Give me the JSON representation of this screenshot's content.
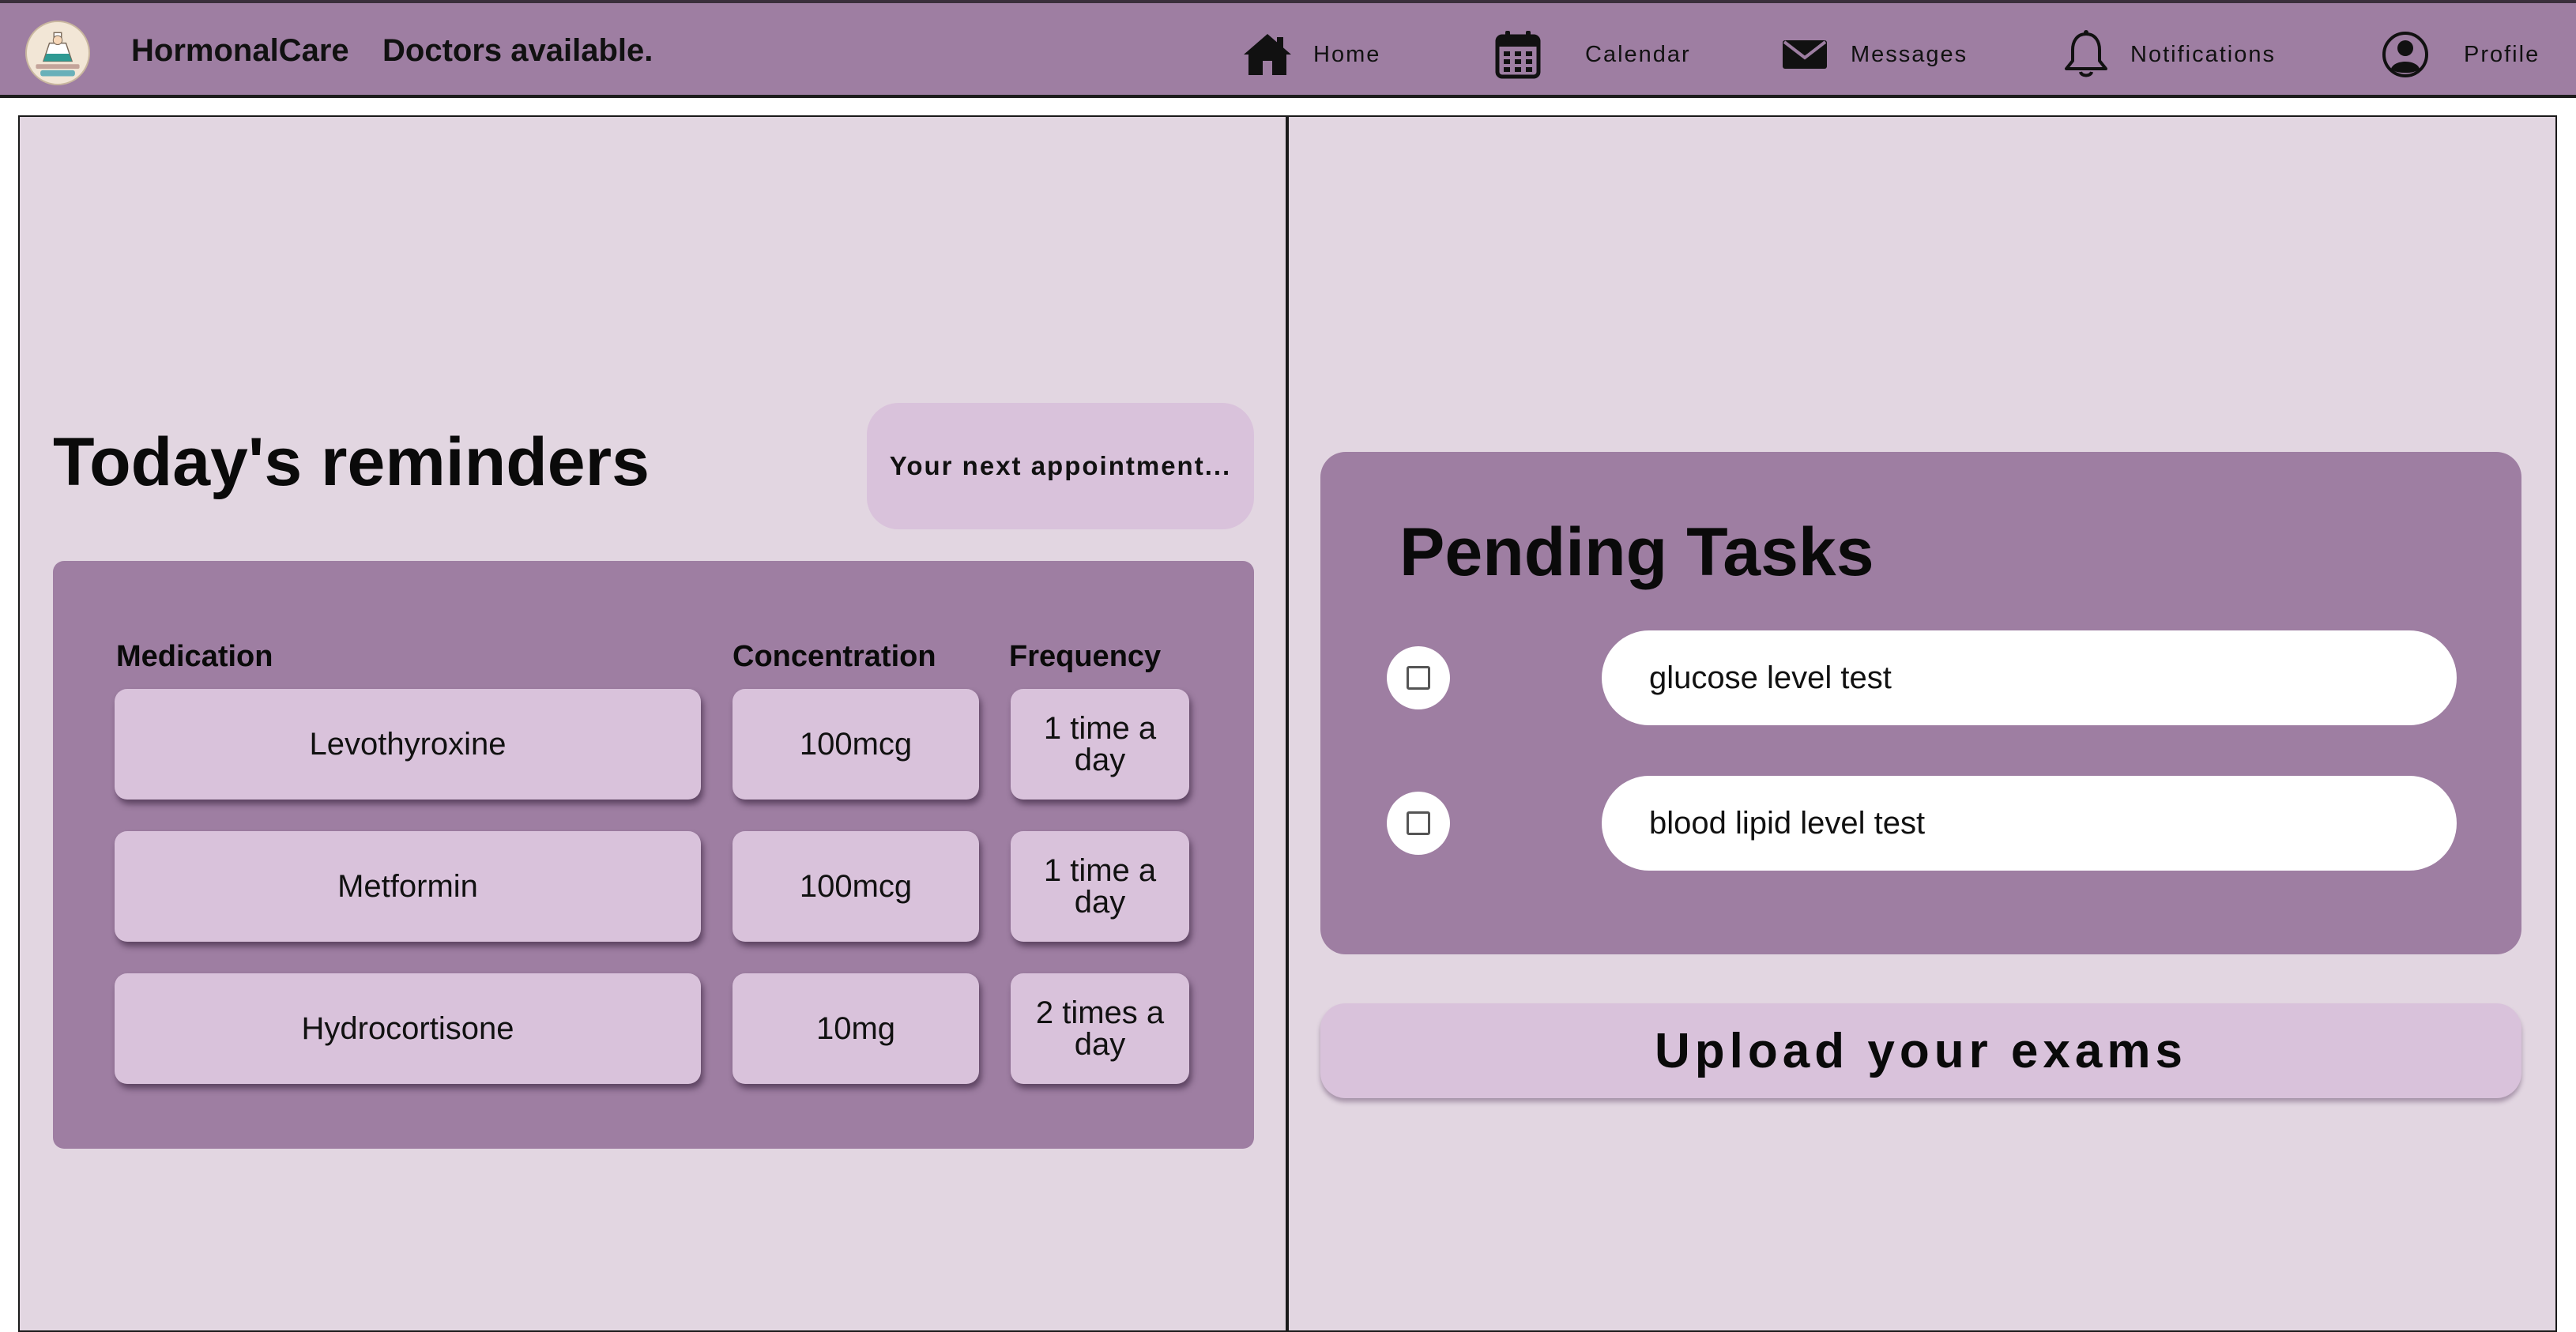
{
  "colors": {
    "nav_background": "#9e7ea2",
    "panel_background": "#e2d6e1",
    "card_background": "#9e7ea2",
    "cell_background": "#d9c2db",
    "pill_background": "#ffffff"
  },
  "header": {
    "logo_icon": "hormonal-care-logo",
    "brand": "HormonalCare",
    "tagline": "Doctors available."
  },
  "nav": {
    "home": {
      "label": "Home",
      "icon": "home-icon"
    },
    "calendar": {
      "label": "Calendar",
      "icon": "calendar-icon"
    },
    "messages": {
      "label": "Messages",
      "icon": "envelope-icon"
    },
    "notifications": {
      "label": "Notifications",
      "icon": "bell-icon"
    },
    "profile": {
      "label": "Profile",
      "icon": "user-circle-icon"
    }
  },
  "reminders": {
    "title": "Today's reminders",
    "appointment_button": "Your next appointment...",
    "columns": {
      "medication": "Medication",
      "concentration": "Concentration",
      "frequency": "Frequency"
    },
    "rows": [
      {
        "medication": "Levothyroxine",
        "concentration": "100mcg",
        "frequency": "1 time a day"
      },
      {
        "medication": "Metformin",
        "concentration": "100mcg",
        "frequency": "1 time a day"
      },
      {
        "medication": "Hydrocortisone",
        "concentration": "10mg",
        "frequency": "2 times a day"
      }
    ]
  },
  "tasks": {
    "title": "Pending Tasks",
    "items": [
      {
        "label": "glucose level test",
        "checked": false
      },
      {
        "label": "blood lipid level test",
        "checked": false
      }
    ],
    "upload_button": "Upload your exams"
  }
}
